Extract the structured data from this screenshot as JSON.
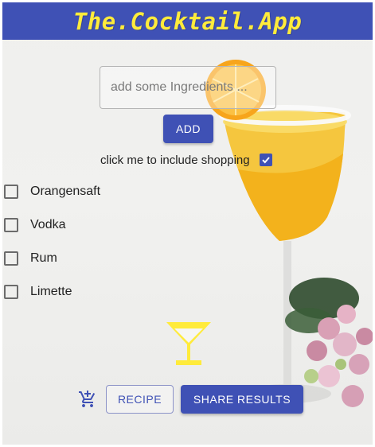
{
  "header": {
    "title": "The.Cocktail.App"
  },
  "search": {
    "placeholder": "add some Ingredients ..."
  },
  "actions": {
    "add_label": "ADD",
    "recipe_label": "RECIPE",
    "share_label": "SHARE RESULTS"
  },
  "shopping": {
    "label": "click me to include shopping",
    "checked": true
  },
  "ingredients": [
    {
      "label": "Orangensaft",
      "checked": false
    },
    {
      "label": "Vodka",
      "checked": false
    },
    {
      "label": "Rum",
      "checked": false
    },
    {
      "label": "Limette",
      "checked": false
    }
  ],
  "icons": {
    "cocktail": "martini-glass-icon",
    "cart": "add-shopping-cart-icon",
    "check": "check-icon"
  },
  "colors": {
    "primary": "#3f51b5",
    "accent": "#ffeb3b",
    "background": "#efefed"
  }
}
